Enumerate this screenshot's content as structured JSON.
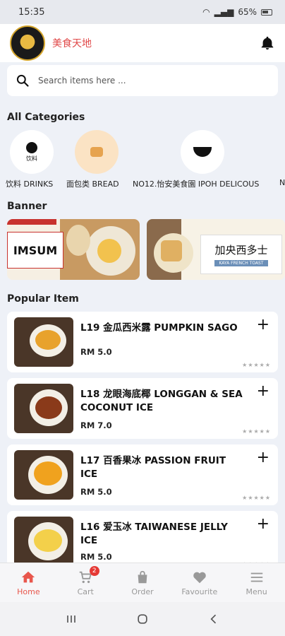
{
  "status": {
    "time": "15:35",
    "battery": "65%"
  },
  "header": {
    "brand_name": "美食天地"
  },
  "search": {
    "placeholder": "Search items here ..."
  },
  "sections": {
    "categories_title": "All Categories",
    "banner_title": "Banner",
    "popular_title": "Popular Item"
  },
  "categories": [
    {
      "label": "饮料 DRINKS"
    },
    {
      "label": "面包类 BREAD"
    },
    {
      "label": "NO12.怡安美食園 IPOH DELICOUS"
    },
    {
      "label": "N"
    }
  ],
  "banners": [
    {
      "text": "IMSUM"
    },
    {
      "text": "加央西多士",
      "tag": "KAYA FRENCH TOAST"
    }
  ],
  "popular_items": [
    {
      "title": "L19 金瓜西米露 PUMPKIN SAGO",
      "price": "RM 5.0",
      "rating": "★★★★★"
    },
    {
      "title": "L18 龙眼海底椰 LONGGAN & SEA COCONUT ICE",
      "price": "RM 7.0",
      "rating": "★★★★★"
    },
    {
      "title": "L17 百香果冰 PASSION FRUIT ICE",
      "price": "RM 5.0",
      "rating": "★★★★★"
    },
    {
      "title": "L16 爱玉冰 TAIWANESE JELLY ICE",
      "price": "RM 5.0",
      "rating": "★★★★★"
    }
  ],
  "bottom_nav": {
    "home": "Home",
    "cart": "Cart",
    "cart_badge": "2",
    "order": "Order",
    "favourite": "Favourite",
    "menu": "Menu"
  },
  "colors": {
    "accent": "#e8564c",
    "brand_text": "#e04848",
    "background": "#eef1f7"
  }
}
